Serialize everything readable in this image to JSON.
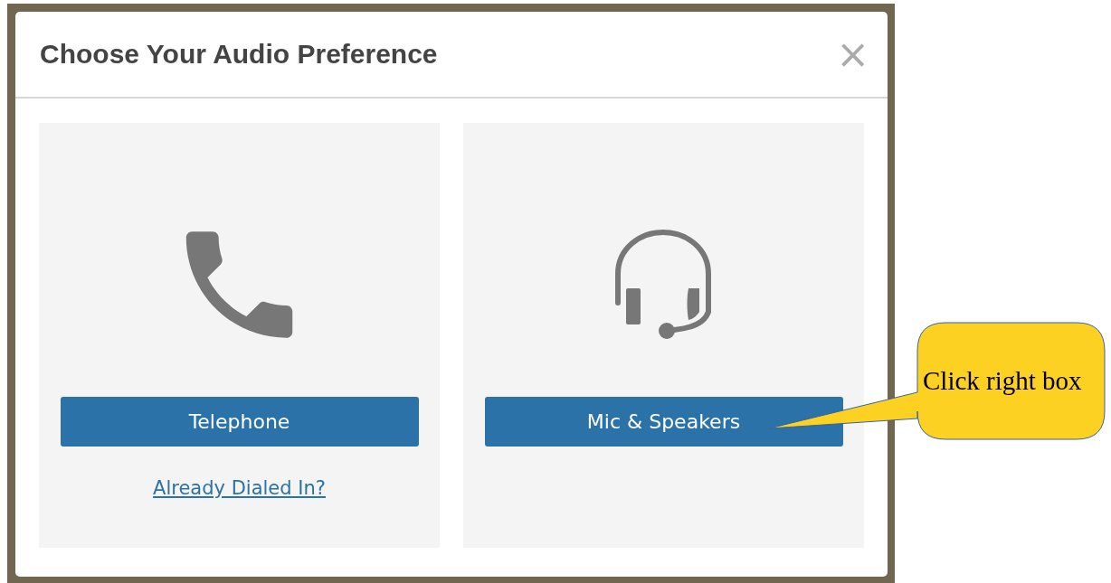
{
  "dialog": {
    "title": "Choose Your Audio Preference",
    "close": "×",
    "options": [
      {
        "kind": "telephone",
        "button": "Telephone",
        "link": "Already Dialed In?"
      },
      {
        "kind": "headset",
        "button": "Mic & Speakers"
      }
    ]
  },
  "callout": {
    "text": "Click right box"
  }
}
